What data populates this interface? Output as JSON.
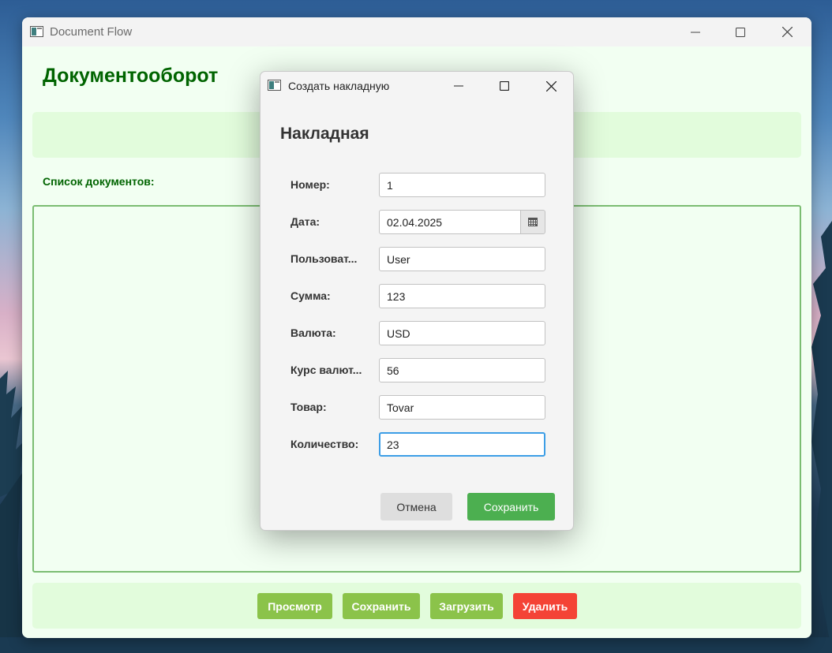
{
  "main_window": {
    "title": "Document Flow",
    "heading": "Документооборот",
    "list_label": "Список документов:",
    "buttons": {
      "view": "Просмотр",
      "save": "Сохранить",
      "load": "Загрузить",
      "delete": "Удалить"
    }
  },
  "dialog": {
    "title": "Создать накладную",
    "heading": "Накладная",
    "fields": {
      "number": {
        "label": "Номер:",
        "value": "1"
      },
      "date": {
        "label": "Дата:",
        "value": "02.04.2025"
      },
      "user": {
        "label": "Пользоват...",
        "value": "User"
      },
      "amount": {
        "label": "Сумма:",
        "value": "123"
      },
      "currency": {
        "label": "Валюта:",
        "value": "USD"
      },
      "rate": {
        "label": "Курс валют...",
        "value": "56"
      },
      "product": {
        "label": "Товар:",
        "value": "Tovar"
      },
      "quantity": {
        "label": "Количество:",
        "value": "23"
      }
    },
    "buttons": {
      "cancel": "Отмена",
      "save": "Сохранить"
    }
  },
  "icons": {
    "app": "app-window-icon",
    "minimize": "minimize-icon",
    "maximize": "maximize-icon",
    "close": "close-icon",
    "calendar": "calendar-icon"
  },
  "colors": {
    "heading_green": "#006400",
    "panel_green": "#e2fcdc",
    "button_green": "#8bc34a",
    "button_red": "#f44336",
    "save_green": "#4caf50",
    "focus_blue": "#3c9ee6"
  }
}
